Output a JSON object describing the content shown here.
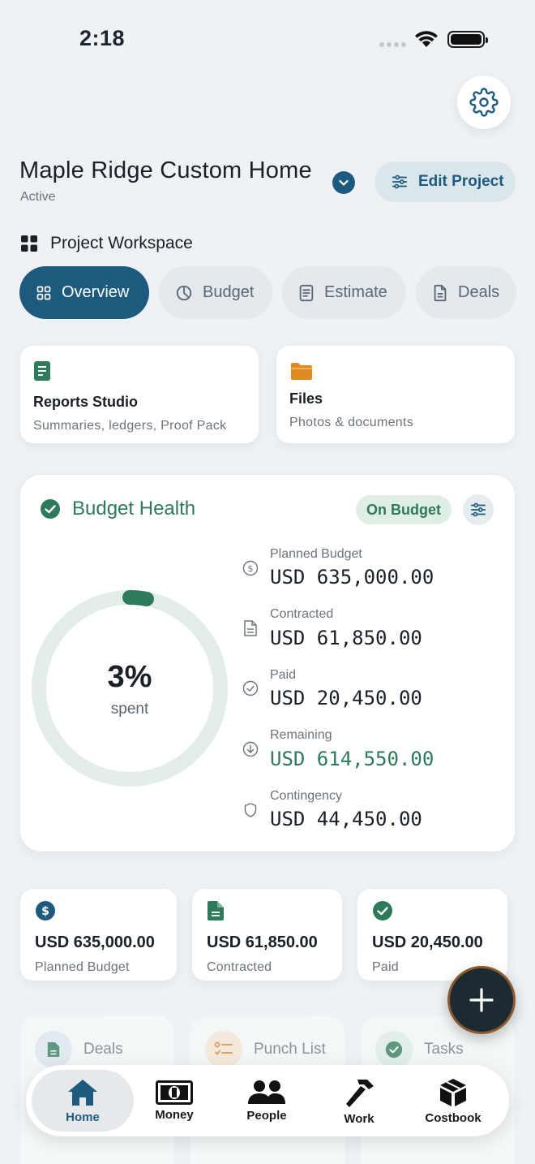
{
  "status_bar": {
    "time": "2:18"
  },
  "project": {
    "name": "Maple Ridge Custom Home",
    "status": "Active",
    "edit_label": "Edit Project"
  },
  "workspace": {
    "title": "Project Workspace",
    "tabs": [
      {
        "label": "Overview",
        "icon": "grid-icon",
        "active": true
      },
      {
        "label": "Budget",
        "icon": "pie-chart-icon",
        "active": false
      },
      {
        "label": "Estimate",
        "icon": "document-icon",
        "active": false
      },
      {
        "label": "Deals",
        "icon": "file-icon",
        "active": false
      }
    ]
  },
  "quick_cards": [
    {
      "title": "Reports Studio",
      "subtitle": "Summaries, ledgers, Proof Pack",
      "icon": "report-icon"
    },
    {
      "title": "Files",
      "subtitle": "Photos & documents",
      "icon": "folder-icon"
    }
  ],
  "budget_health": {
    "title": "Budget Health",
    "badge": "On Budget",
    "percent_spent": 3,
    "percent_label": "3%",
    "spent_label": "spent",
    "rows": [
      {
        "label": "Planned Budget",
        "value": "USD 635,000.00",
        "icon": "dollar-icon"
      },
      {
        "label": "Contracted",
        "value": "USD 61,850.00",
        "icon": "document-icon"
      },
      {
        "label": "Paid",
        "value": "USD 20,450.00",
        "icon": "check-circle-icon"
      },
      {
        "label": "Remaining",
        "value": "USD 614,550.00",
        "icon": "arrow-down-circle-icon",
        "highlight": true
      },
      {
        "label": "Contingency",
        "value": "USD 44,450.00",
        "icon": "shield-icon"
      }
    ],
    "colors": {
      "accent": "#2e7a5a",
      "ring_track": "#e2eee7"
    }
  },
  "metric_cards": [
    {
      "value": "USD 635,000.00",
      "label": "Planned Budget",
      "icon": "dollar-icon"
    },
    {
      "value": "USD 61,850.00",
      "label": "Contracted",
      "icon": "document-icon"
    },
    {
      "value": "USD 20,450.00",
      "label": "Paid",
      "icon": "check-circle-icon"
    }
  ],
  "lower_cards": [
    {
      "title": "Deals",
      "icon": "file-icon"
    },
    {
      "title": "Punch List",
      "icon": "checklist-icon"
    },
    {
      "title": "Tasks",
      "icon": "check-circle-icon"
    }
  ],
  "bottom_nav": [
    {
      "label": "Home",
      "icon": "home-icon",
      "active": true
    },
    {
      "label": "Money",
      "icon": "money-icon",
      "active": false
    },
    {
      "label": "People",
      "icon": "people-icon",
      "active": false
    },
    {
      "label": "Work",
      "icon": "hammer-icon",
      "active": false
    },
    {
      "label": "Costbook",
      "icon": "box-icon",
      "active": false
    }
  ],
  "colors": {
    "primary": "#1e5a7e",
    "background": "#eef2f5",
    "success": "#2e7a5a"
  }
}
